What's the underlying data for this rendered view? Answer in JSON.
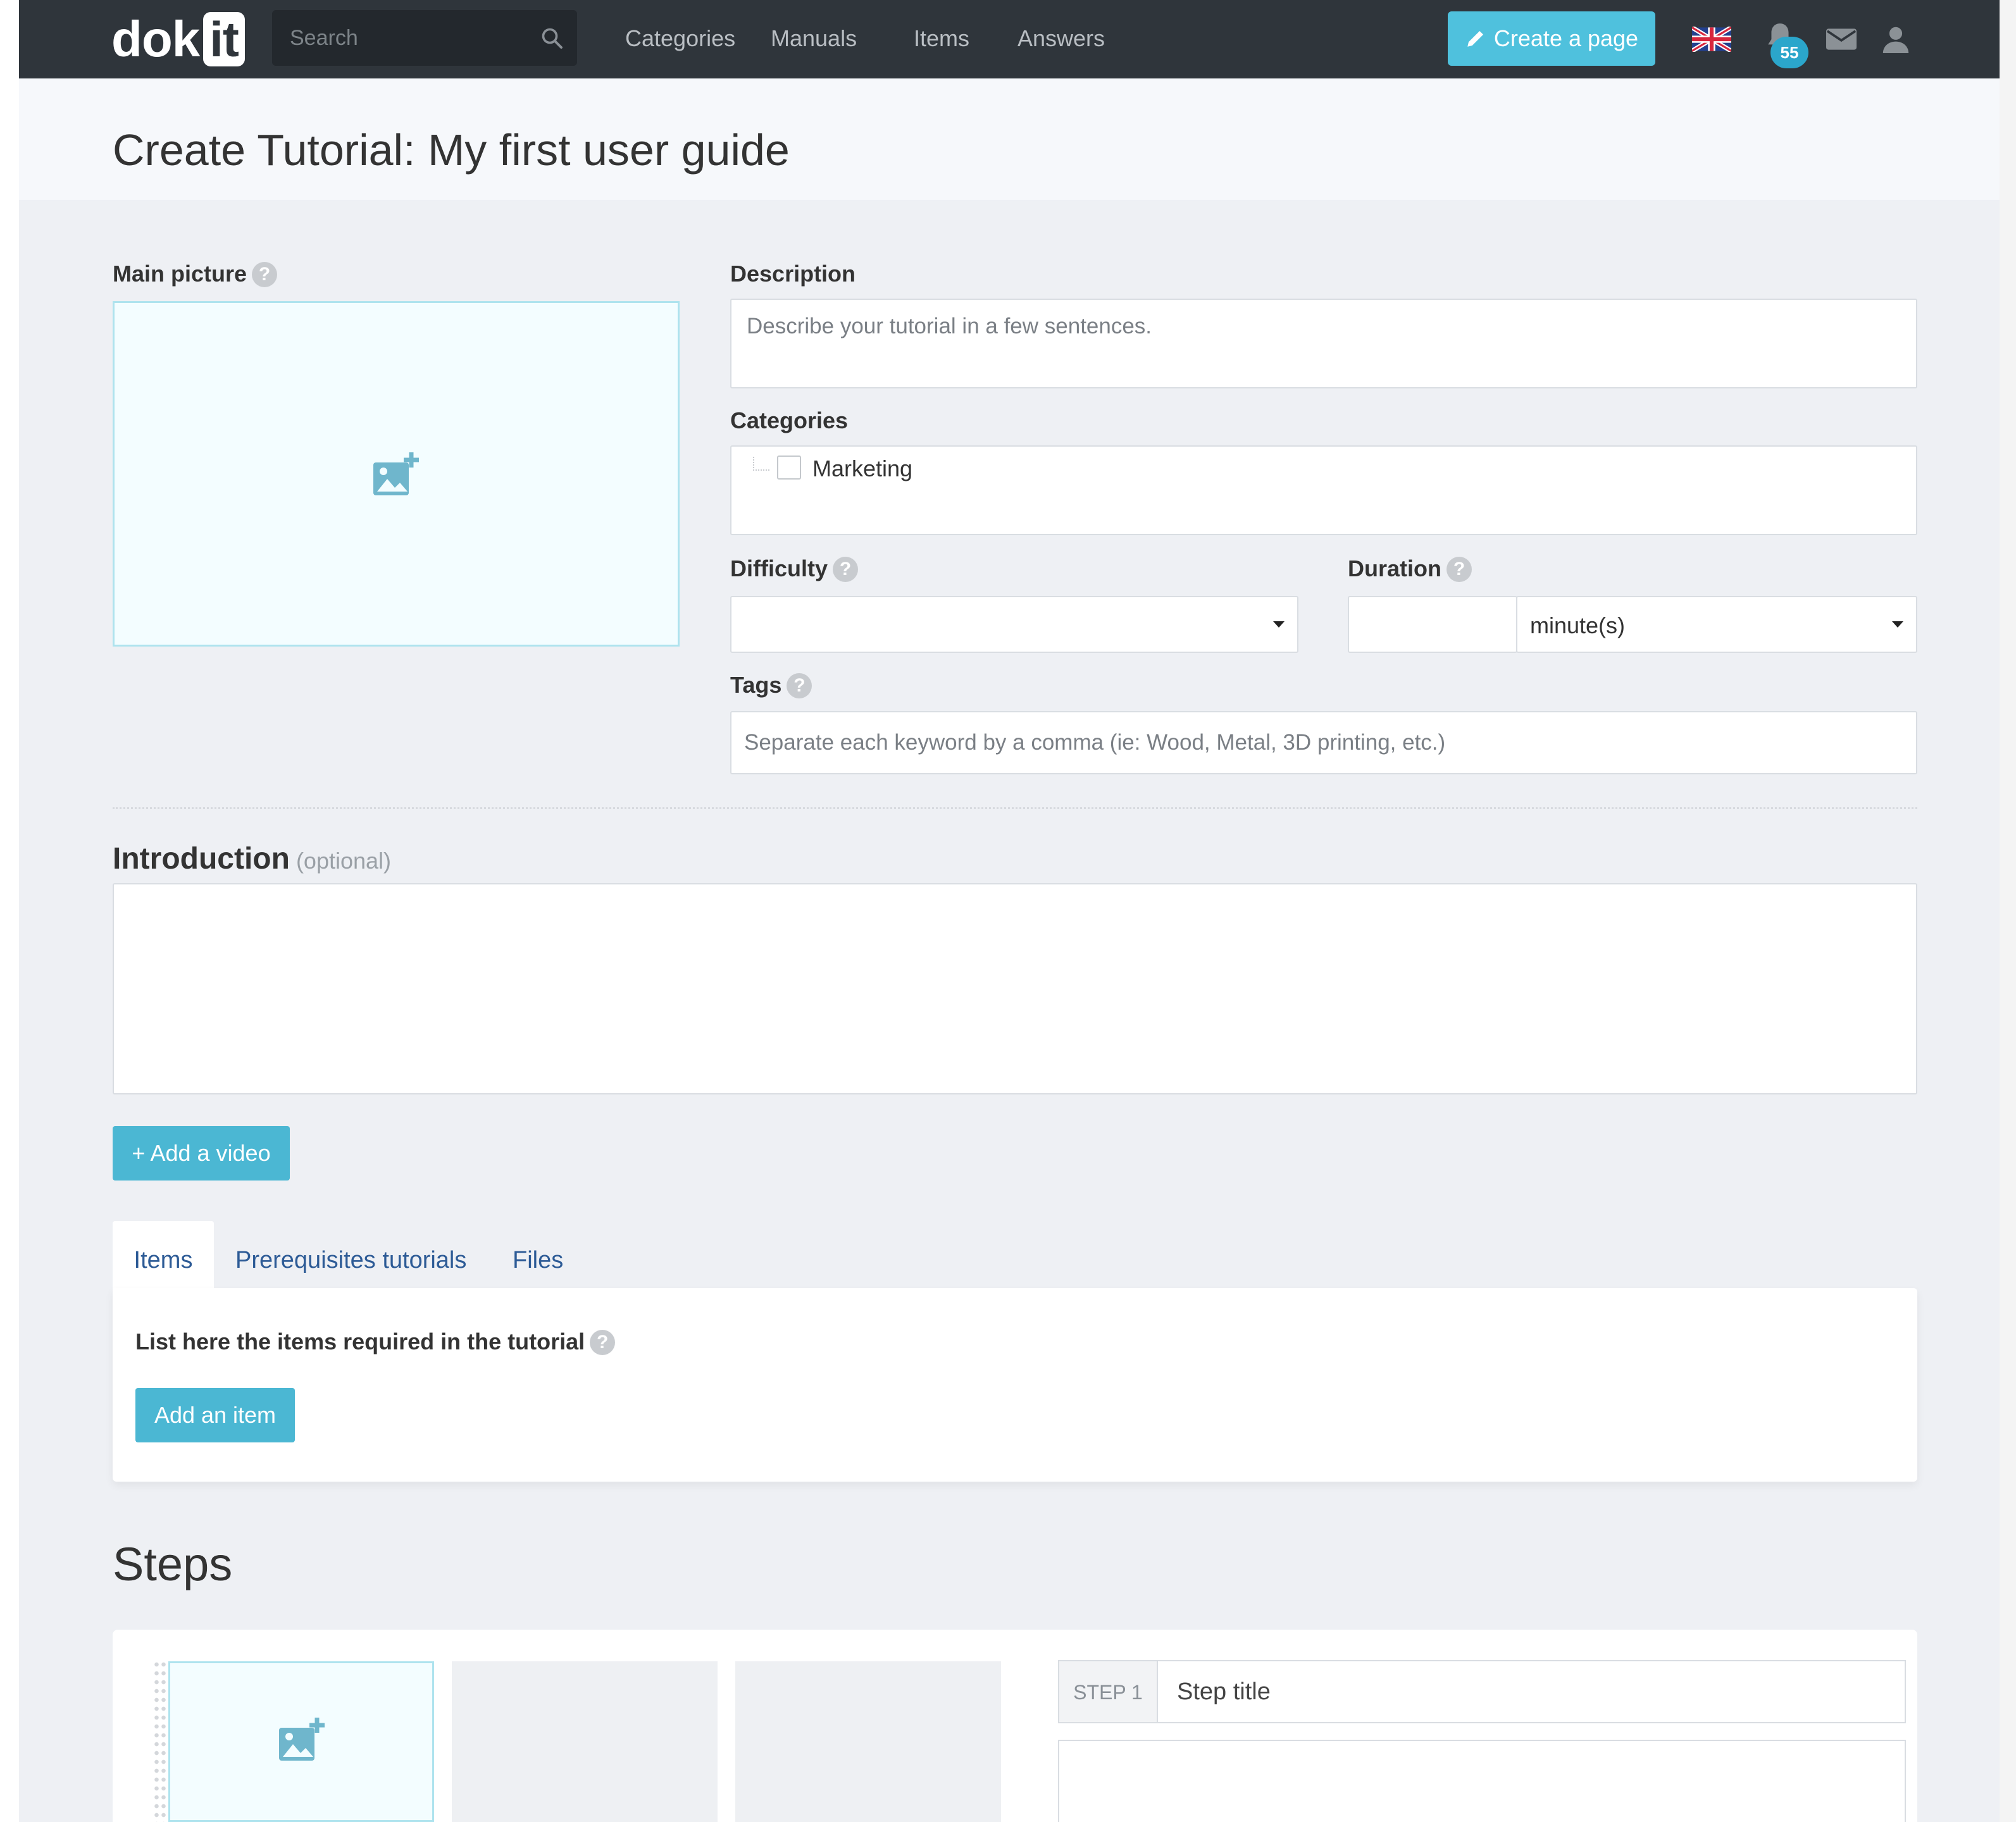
{
  "nav": {
    "logo_text": "dok",
    "logo_badge": "it",
    "search_placeholder": "Search",
    "links": [
      "Categories",
      "Manuals",
      "Items",
      "Answers"
    ],
    "create_label": "Create a page",
    "notification_count": "55",
    "icons": [
      "search-icon",
      "pencil-icon",
      "uk-flag-icon",
      "bell-icon",
      "mail-icon",
      "user-icon"
    ]
  },
  "page": {
    "title": "Create Tutorial: My first user guide"
  },
  "form": {
    "main_picture_label": "Main picture",
    "description_label": "Description",
    "description_placeholder": "Describe your tutorial in a few sentences.",
    "categories_label": "Categories",
    "categories": [
      {
        "label": "Marketing",
        "checked": false
      }
    ],
    "difficulty_label": "Difficulty",
    "difficulty_value": "",
    "duration_label": "Duration",
    "duration_value": "",
    "duration_unit": "minute(s)",
    "tags_label": "Tags",
    "tags_placeholder": "Separate each keyword by a comma (ie: Wood, Metal, 3D printing, etc.)",
    "help_glyph": "?"
  },
  "introduction": {
    "title": "Introduction",
    "optional": "(optional)",
    "value": "",
    "add_video_label": "+ Add a video"
  },
  "tabs": {
    "labels": [
      "Items",
      "Prerequisites tutorials",
      "Files"
    ],
    "active": "Items",
    "items_heading": "List here the items required in the tutorial",
    "add_item_label": "Add an item"
  },
  "steps": {
    "title": "Steps",
    "step_label": "STEP 1",
    "step_title_placeholder": "Step title"
  },
  "colors": {
    "navbar": "#2f353b",
    "accent": "#4bb7d3",
    "badge": "#2ba6cb",
    "tab_link": "#2d5b96"
  }
}
